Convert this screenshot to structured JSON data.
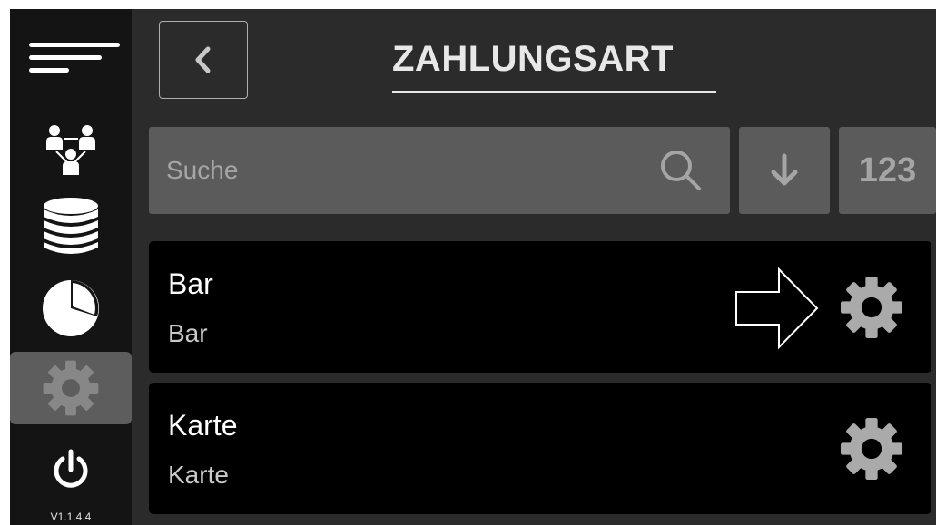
{
  "sidebar": {
    "version": "V1.1.4.4",
    "items": [
      {
        "icon": "menu-icon"
      },
      {
        "icon": "users-hierarchy-icon"
      },
      {
        "icon": "database-icon"
      },
      {
        "icon": "pie-chart-icon"
      },
      {
        "icon": "gear-icon",
        "active": true
      },
      {
        "icon": "power-icon"
      }
    ]
  },
  "header": {
    "title": "ZAHLUNGSART",
    "back_icon": "chevron-left-icon"
  },
  "search": {
    "placeholder": "Suche",
    "value": "",
    "icon": "search-icon"
  },
  "toolbar": {
    "sort_icon": "arrow-down-icon",
    "numeric_label": "123"
  },
  "list": [
    {
      "title": "Bar",
      "subtitle": "Bar",
      "icon": "gear-icon",
      "highlighted_with_arrow": true
    },
    {
      "title": "Karte",
      "subtitle": "Karte",
      "icon": "gear-icon",
      "highlighted_with_arrow": false
    }
  ],
  "colors": {
    "background": "#2b2b2b",
    "sidebar": "#141414",
    "sidebar_active": "#5d5d5d",
    "control": "#5b5b5b",
    "row": "#000000",
    "text": "#ffffff",
    "muted_text": "#a5a5a5"
  }
}
